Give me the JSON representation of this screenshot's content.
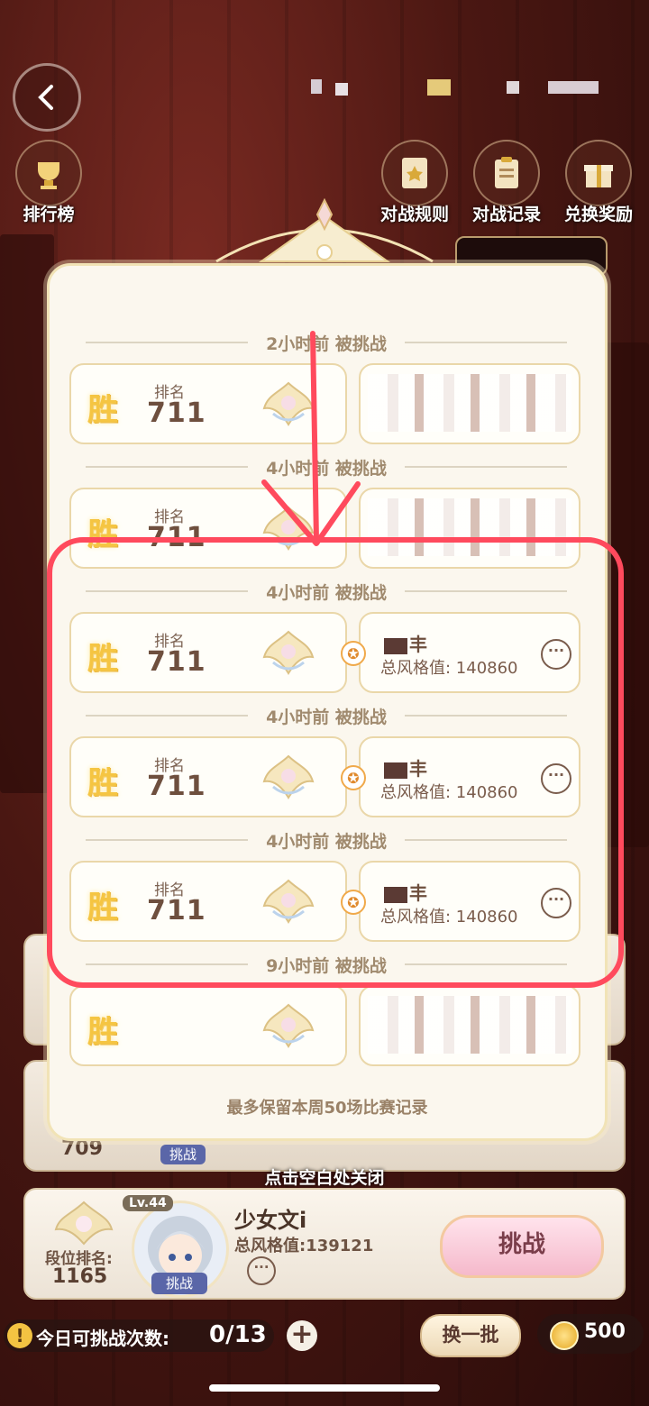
{
  "top_icons": [
    {
      "label": "排行榜",
      "icon": "trophy-icon"
    },
    {
      "label": "对战规则",
      "icon": "rule-book-icon"
    },
    {
      "label": "对战记录",
      "icon": "clipboard-icon"
    },
    {
      "label": "兑换奖励",
      "icon": "gift-icon"
    }
  ],
  "records": [
    {
      "time": "2小时前 被挑战",
      "result": "胜",
      "rank_label": "排名",
      "rank": "711",
      "name": "",
      "style": "",
      "masked": true
    },
    {
      "time": "4小时前 被挑战",
      "result": "胜",
      "rank_label": "排名",
      "rank": "711",
      "name": "",
      "style": "",
      "masked": true
    },
    {
      "time": "4小时前 被挑战",
      "result": "胜",
      "rank_label": "排名",
      "rank": "711",
      "name": "丰",
      "style": "总风格值: 140860",
      "masked": false
    },
    {
      "time": "4小时前 被挑战",
      "result": "胜",
      "rank_label": "排名",
      "rank": "711",
      "name": "丰",
      "style": "总风格值: 140860",
      "masked": false
    },
    {
      "time": "4小时前 被挑战",
      "result": "胜",
      "rank_label": "排名",
      "rank": "711",
      "name": "丰",
      "style": "总风格值: 140860",
      "masked": false
    },
    {
      "time": "9小时前 被挑战",
      "result": "胜",
      "rank_label": "",
      "rank": "",
      "name": "",
      "style": "",
      "masked": true
    }
  ],
  "modal_footer": "最多保留本周50场比赛记录",
  "close_hint": "点击空白处关闭",
  "behind_rank": "709",
  "behind_challenge": "挑战",
  "player": {
    "level": "Lv.44",
    "name": "少女文i",
    "style": "总风格值:139121",
    "rank_label": "段位排名:",
    "rank": "1165",
    "avatar_badge": "挑战",
    "challenge_button": "挑战"
  },
  "bottom_bar": {
    "attempts_label": "今日可挑战次数:",
    "attempts_value": "0/13",
    "refresh_button": "换一批",
    "coins": "500"
  },
  "colors": {
    "annotation_red": "#ff4a5d",
    "win_gold": "#f5c542"
  }
}
